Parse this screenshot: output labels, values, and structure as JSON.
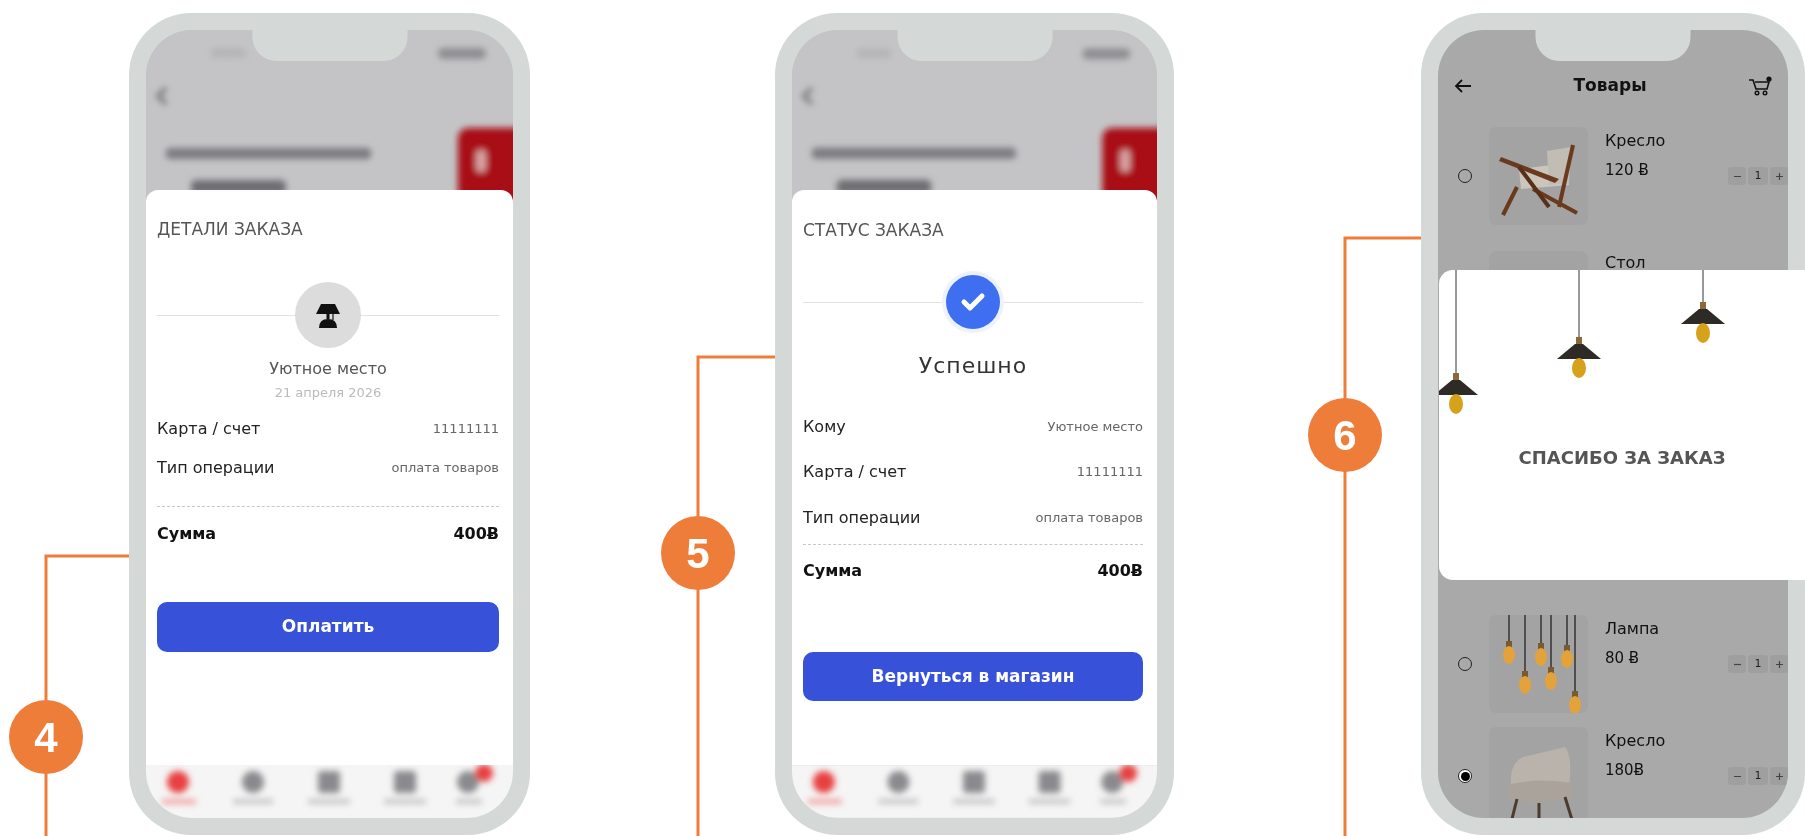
{
  "screens": [
    {
      "kind": "order_details",
      "marker": "4",
      "title": "ДЕТАЛИ ЗАКАЗА",
      "merchant": "Уютное место",
      "date": "21 апреля 2026",
      "rows": [
        {
          "label": "Карта / счет",
          "value": "11111111"
        },
        {
          "label": "Тип операции",
          "value": "оплата товаров"
        }
      ],
      "total": {
        "label": "Сумма",
        "value": "400Ƀ"
      },
      "button": "Оплатить"
    },
    {
      "kind": "order_status",
      "marker": "5",
      "title": "СТАТУС ЗАКАЗА",
      "status": "Успешно",
      "rows": [
        {
          "label": "Кому",
          "value": "Уютное место"
        },
        {
          "label": "Карта / счет",
          "value": "11111111"
        },
        {
          "label": "Тип операции",
          "value": "оплата товаров"
        }
      ],
      "total": {
        "label": "Сумма",
        "value": "400Ƀ"
      },
      "button": "Вернуться в магазин"
    },
    {
      "kind": "products",
      "marker": "6",
      "title": "Товары",
      "products": [
        {
          "name": "Кресло",
          "price": "120 Ƀ",
          "quantity": "1",
          "selected": false
        },
        {
          "name": "Стол"
        },
        {
          "name": "Лампа",
          "price": "80 Ƀ",
          "quantity": "1",
          "selected": false
        },
        {
          "name": "Кресло",
          "price": "180Ƀ",
          "quantity": "1",
          "selected": true
        }
      ],
      "dialog": {
        "message": "СПАСИБО ЗА ЗАКАЗ"
      }
    }
  ]
}
